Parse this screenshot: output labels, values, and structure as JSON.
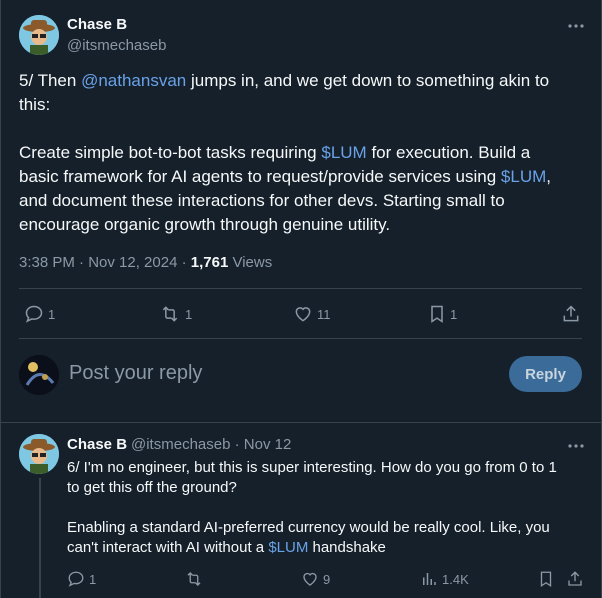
{
  "tweet": {
    "author_name": "Chase B",
    "author_handle": "@itsmechaseb",
    "line1_pre": "5/ Then ",
    "line1_mention": "@nathansvan",
    "line1_post": " jumps in, and we get down to something akin to",
    "line2": "this:",
    "para2_a": "Create simple bot-to-bot tasks requiring ",
    "para2_cashtag1": "$LUM",
    "para2_b": " for execution. Build a",
    "para2_c": "basic framework for AI agents to request/provide services using ",
    "para2_cashtag2": "$LUM",
    "para2_d": ",",
    "para2_e": "and document these interactions for other devs. Starting small to",
    "para2_f": "encourage organic growth through genuine utility.",
    "timestamp": "3:38 PM · Nov 12, 2024 · ",
    "views_count": "1,761",
    "views_label": " Views",
    "stats": {
      "replies": "1",
      "reposts": "1",
      "likes": "11",
      "bookmarks": "1"
    }
  },
  "composer": {
    "placeholder": "Post your reply",
    "reply_button": "Reply"
  },
  "reply_tweet": {
    "author_name": "Chase B",
    "author_handle": "@itsmechaseb",
    "date": "· Nov 12",
    "line1": "6/ I'm no engineer, but this is super interesting. How do you go from 0 to 1",
    "line2": "to get this off the ground?",
    "line3": "Enabling a standard AI-preferred currency would be really cool. Like, you",
    "line4_pre": "can't interact with AI without a ",
    "line4_cashtag": "$LUM",
    "line4_post": " handshake",
    "stats": {
      "replies": "1",
      "reposts": "",
      "likes": "9",
      "views": "1.4K"
    }
  },
  "colors": {
    "background": "#15202b",
    "accent": "#6aa2e8",
    "muted": "#8b98a5",
    "button": "#3b6b99"
  }
}
